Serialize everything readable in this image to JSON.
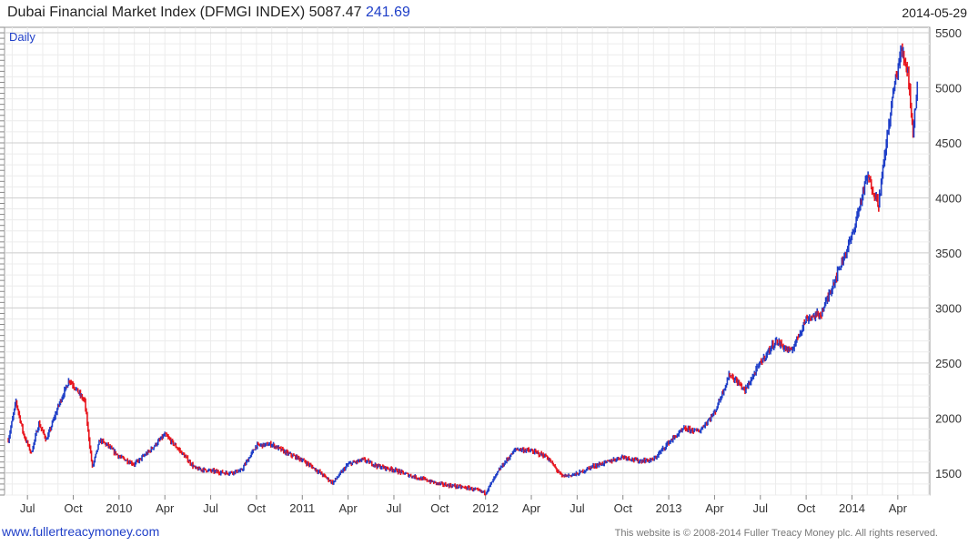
{
  "header": {
    "title": "Dubai Financial Market Index (DFMGI INDEX) 5087.47",
    "change": "241.69",
    "date": "2014-05-29"
  },
  "footer": {
    "link": "www.fullertreacymoney.com",
    "copyright": "This website is © 2008-2014 Fuller Treacy Money plc. All rights reserved."
  },
  "colors": {
    "up": "#1f3fc8",
    "down": "#e8141c",
    "grid": "#d6d6d6",
    "label": "#1f3fc8"
  },
  "chart_data": {
    "type": "line",
    "style": "high-low bars (blue up, red down)",
    "interval_label": "Daily",
    "x_ticks": [
      "Jul",
      "Oct",
      "2010",
      "Apr",
      "Jul",
      "Oct",
      "2011",
      "Apr",
      "Jul",
      "Oct",
      "2012",
      "Apr",
      "Jul",
      "Oct",
      "2013",
      "Apr",
      "Jul",
      "Oct",
      "2014",
      "Apr"
    ],
    "y_ticks": [
      1500,
      2000,
      2500,
      3000,
      3500,
      4000,
      4500,
      5000,
      5500
    ],
    "ylim": [
      1300,
      5550
    ],
    "y_axis_side": "right",
    "grid": true,
    "x_range": [
      "2009-06",
      "2014-05"
    ],
    "series": [
      {
        "points": [
          [
            "2009-06",
            1800
          ],
          [
            "2009-06",
            2150
          ],
          [
            "2009-07",
            1850
          ],
          [
            "2009-07",
            1680
          ],
          [
            "2009-08",
            1950
          ],
          [
            "2009-08",
            1800
          ],
          [
            "2009-09",
            2100
          ],
          [
            "2009-10",
            2350
          ],
          [
            "2009-10",
            2250
          ],
          [
            "2009-11",
            2150
          ],
          [
            "2009-11",
            1550
          ],
          [
            "2009-12",
            1800
          ],
          [
            "2009-12",
            1750
          ],
          [
            "2010-01",
            1650
          ],
          [
            "2010-02",
            1580
          ],
          [
            "2010-03",
            1700
          ],
          [
            "2010-04",
            1850
          ],
          [
            "2010-05",
            1700
          ],
          [
            "2010-06",
            1540
          ],
          [
            "2010-07",
            1520
          ],
          [
            "2010-08",
            1500
          ],
          [
            "2010-09",
            1520
          ],
          [
            "2010-10",
            1750
          ],
          [
            "2010-11",
            1760
          ],
          [
            "2010-12",
            1680
          ],
          [
            "2011-01",
            1620
          ],
          [
            "2011-02",
            1520
          ],
          [
            "2011-03",
            1410
          ],
          [
            "2011-04",
            1580
          ],
          [
            "2011-05",
            1620
          ],
          [
            "2011-06",
            1560
          ],
          [
            "2011-07",
            1530
          ],
          [
            "2011-08",
            1480
          ],
          [
            "2011-09",
            1440
          ],
          [
            "2011-10",
            1400
          ],
          [
            "2011-11",
            1380
          ],
          [
            "2011-12",
            1360
          ],
          [
            "2012-01",
            1320
          ],
          [
            "2012-02",
            1550
          ],
          [
            "2012-03",
            1720
          ],
          [
            "2012-04",
            1700
          ],
          [
            "2012-05",
            1650
          ],
          [
            "2012-06",
            1470
          ],
          [
            "2012-07",
            1490
          ],
          [
            "2012-08",
            1560
          ],
          [
            "2012-09",
            1600
          ],
          [
            "2012-10",
            1650
          ],
          [
            "2012-11",
            1610
          ],
          [
            "2012-12",
            1620
          ],
          [
            "2013-01",
            1780
          ],
          [
            "2013-02",
            1900
          ],
          [
            "2013-03",
            1880
          ],
          [
            "2013-04",
            2050
          ],
          [
            "2013-05",
            2400
          ],
          [
            "2013-06",
            2250
          ],
          [
            "2013-07",
            2500
          ],
          [
            "2013-08",
            2700
          ],
          [
            "2013-09",
            2600
          ],
          [
            "2013-10",
            2900
          ],
          [
            "2013-11",
            2950
          ],
          [
            "2013-12",
            3300
          ],
          [
            "2014-01",
            3650
          ],
          [
            "2014-02",
            4200
          ],
          [
            "2014-03",
            3950
          ],
          [
            "2014-03",
            4500
          ],
          [
            "2014-04",
            5000
          ],
          [
            "2014-04",
            5350
          ],
          [
            "2014-05",
            5150
          ],
          [
            "2014-05",
            4600
          ],
          [
            "2014-05",
            5087
          ]
        ]
      }
    ]
  }
}
